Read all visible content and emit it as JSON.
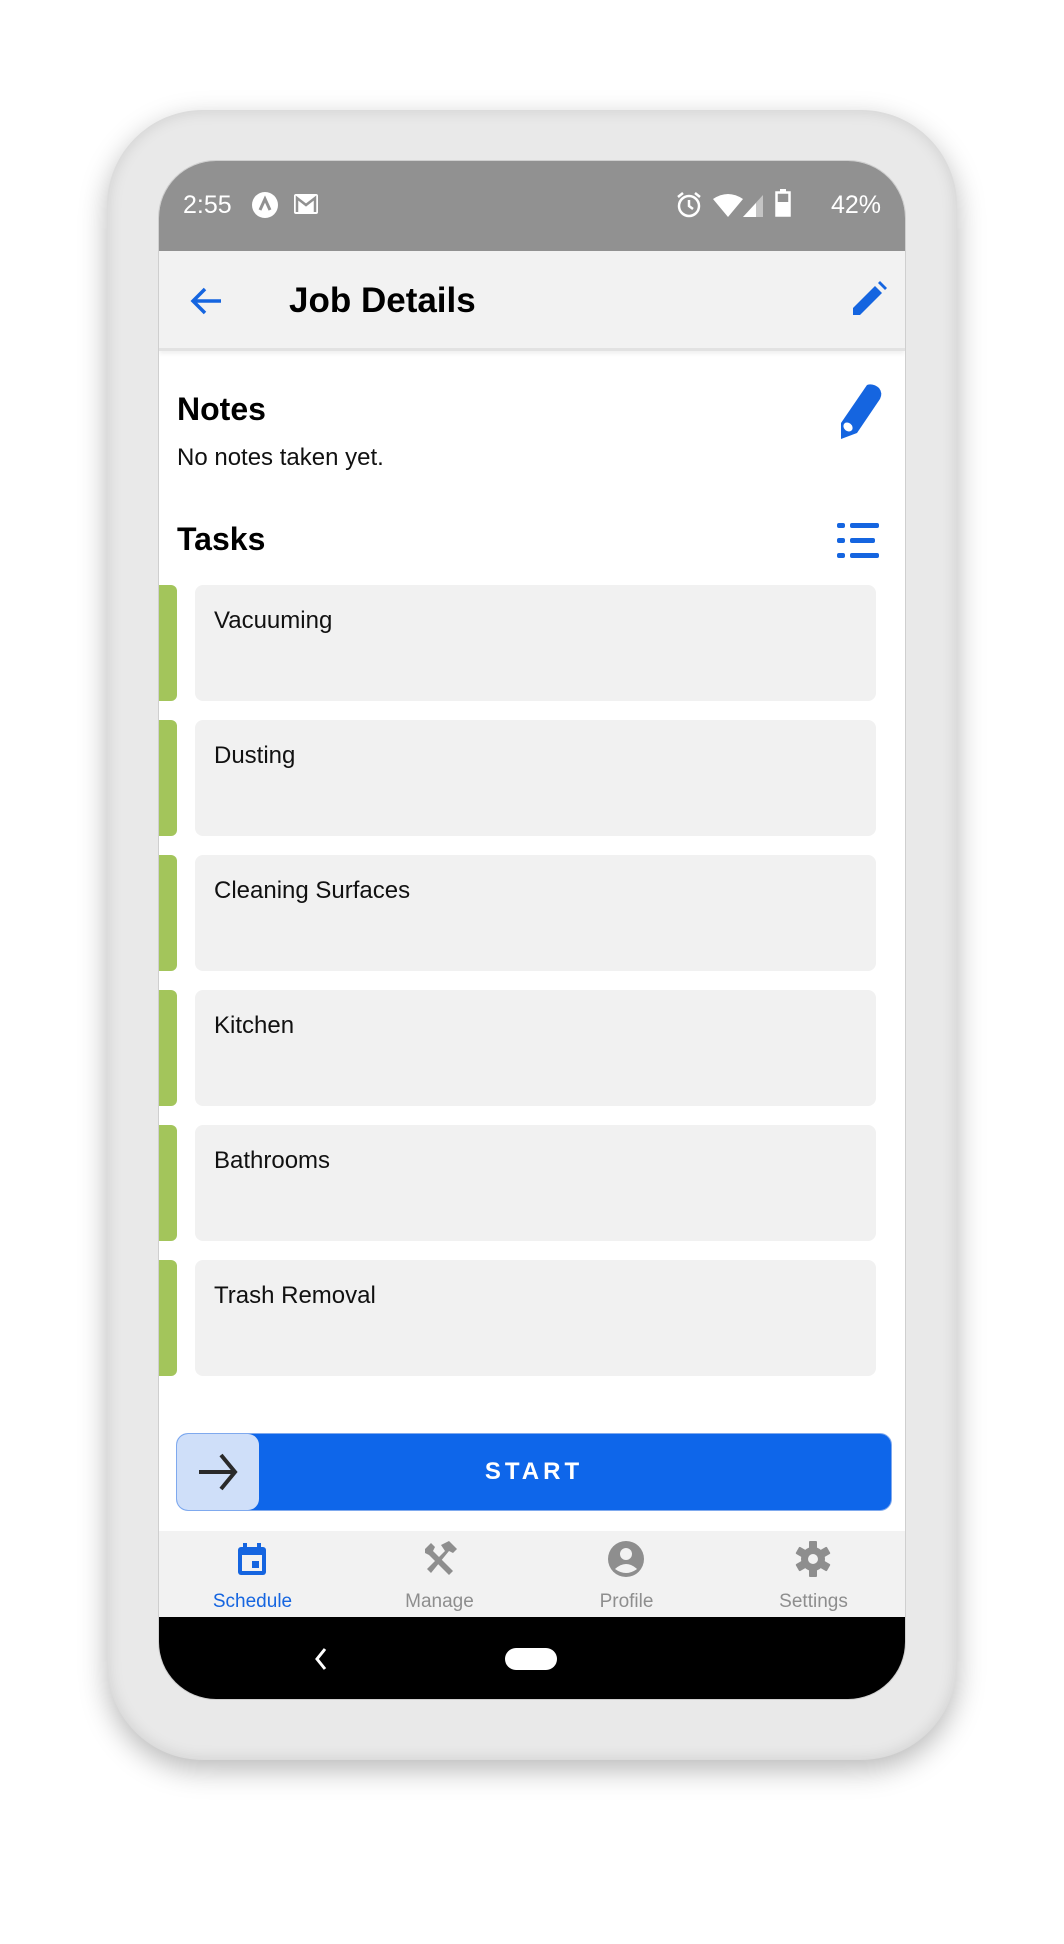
{
  "status_bar": {
    "time": "2:55",
    "left_icons": [
      "app-notification-icon",
      "gmail-icon"
    ],
    "right_icons": [
      "alarm-icon",
      "wifi-icon",
      "cell-signal-icon",
      "battery-icon"
    ],
    "battery_percent": "42%"
  },
  "app_bar": {
    "title": "Job Details",
    "back_icon": "arrow-left-icon",
    "edit_icon": "pencil-icon"
  },
  "notes": {
    "title": "Notes",
    "text": "No notes taken yet.",
    "edit_icon": "pencil-icon"
  },
  "tasks": {
    "title": "Tasks",
    "list_icon": "list-icon",
    "items": [
      {
        "label": "Vacuuming"
      },
      {
        "label": "Dusting"
      },
      {
        "label": "Cleaning Surfaces"
      },
      {
        "label": "Kitchen"
      },
      {
        "label": "Bathrooms"
      },
      {
        "label": "Trash Removal"
      }
    ]
  },
  "start_slider": {
    "label": "START",
    "handle_icon": "arrow-right-icon"
  },
  "bottom_nav": {
    "items": [
      {
        "label": "Schedule",
        "icon": "calendar-icon",
        "active": true
      },
      {
        "label": "Manage",
        "icon": "tools-icon",
        "active": false
      },
      {
        "label": "Profile",
        "icon": "account-circle-icon",
        "active": false
      },
      {
        "label": "Settings",
        "icon": "gear-icon",
        "active": false
      }
    ]
  },
  "colors": {
    "accent": "#0e66ea",
    "task_status": "#a3c55b",
    "status_bar": "#919191",
    "inactive_nav": "#8e8e8e"
  }
}
